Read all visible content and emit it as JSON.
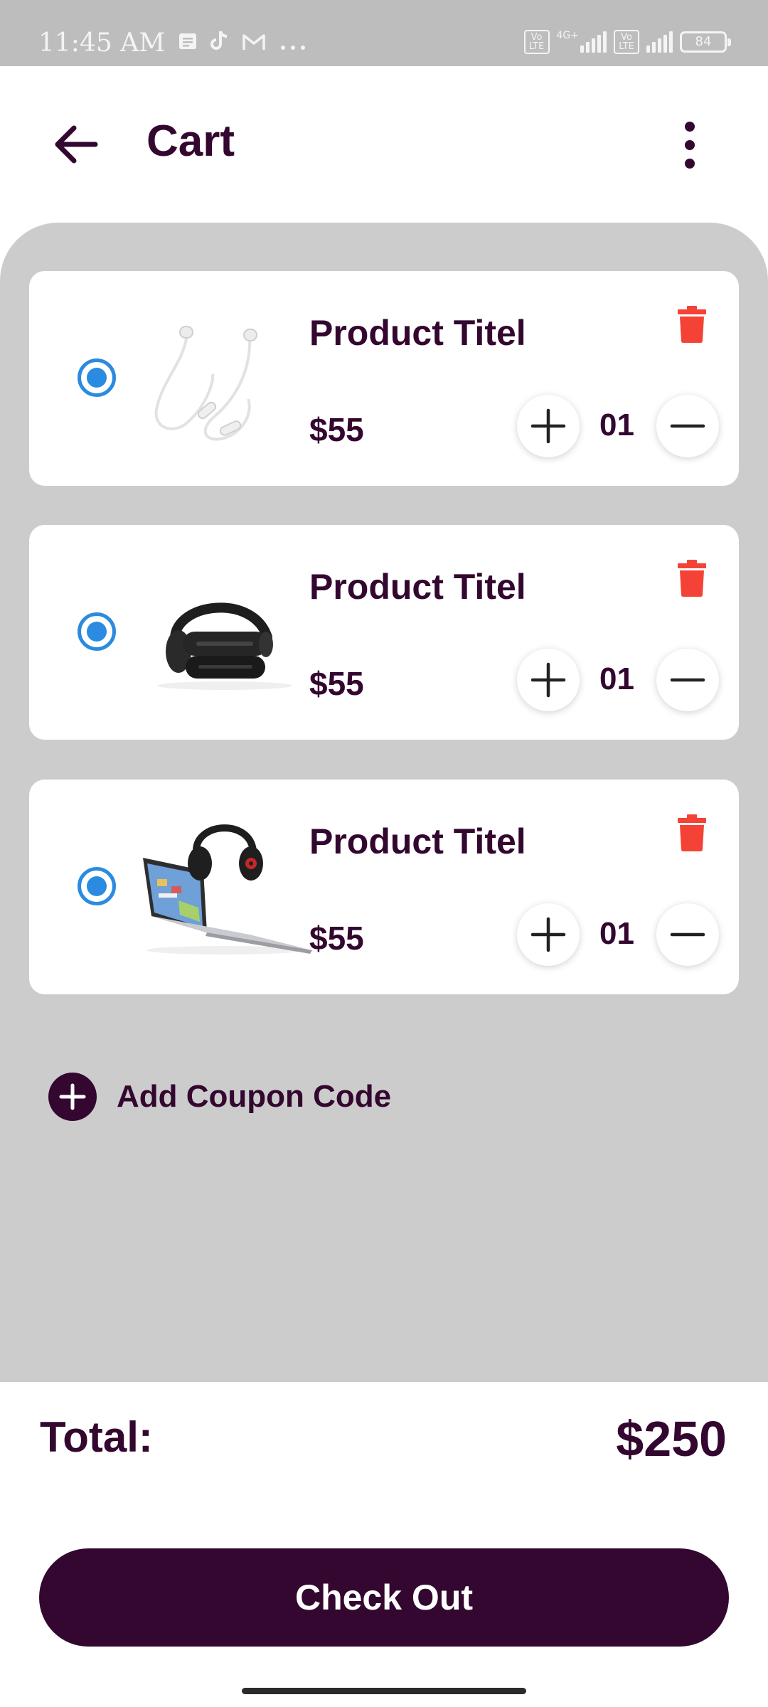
{
  "status_bar": {
    "time": "11:45 AM",
    "network_type": "4G+",
    "volte_label_1": "Vo LTE",
    "volte_label_2": "Vo LTE",
    "battery_level": "84",
    "icons": [
      "message-icon",
      "tiktok-icon",
      "gmail-icon",
      "more-dots-icon",
      "signal-icon",
      "battery-icon"
    ]
  },
  "header": {
    "title": "Cart",
    "back_icon": "arrow-left-icon",
    "menu_icon": "more-vertical-icon"
  },
  "cart": {
    "items": [
      {
        "title": "Product Titel",
        "price": "$55",
        "quantity": "01",
        "selected": true,
        "image": "earphones"
      },
      {
        "title": "Product Titel",
        "price": "$55",
        "quantity": "01",
        "selected": true,
        "image": "headphones"
      },
      {
        "title": "Product Titel",
        "price": "$55",
        "quantity": "01",
        "selected": true,
        "image": "laptop-headphones"
      }
    ]
  },
  "coupon": {
    "label": "Add Coupon Code"
  },
  "footer": {
    "total_label": "Total:",
    "total_value": "$250",
    "checkout_label": "Check Out"
  },
  "colors": {
    "primary": "#33072f",
    "accent_radio": "#2a8be0",
    "delete": "#f44336",
    "background_panel": "#cccccc"
  }
}
